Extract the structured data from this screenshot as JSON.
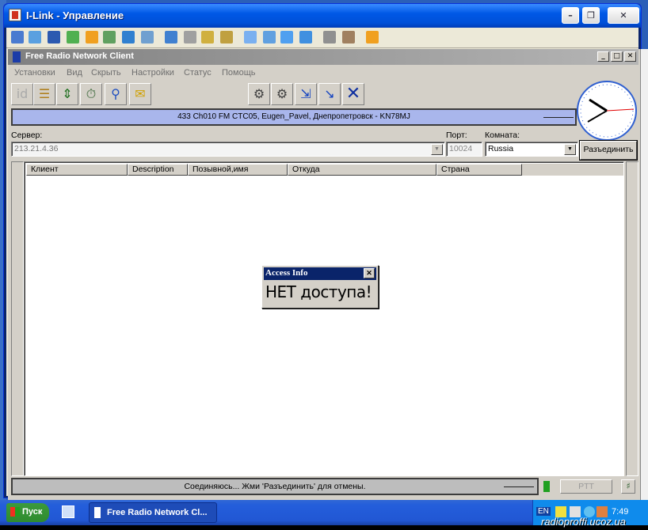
{
  "outer": {
    "title": "I-Link - Управление"
  },
  "inner": {
    "title": "Free Radio Network Client",
    "menu": [
      "Установки",
      "Вид",
      "Скрыть",
      "Настройки",
      "Статус",
      "Помощь"
    ],
    "status_text": "433 Ch010 FM CTC05, Eugen_Pavel, Днепропетровск - KN78MJ",
    "server_label": "Сервер:",
    "server_value": "213.21.4.36",
    "port_label": "Порт:",
    "port_value": "10024",
    "room_label": "Комната:",
    "room_value": "Russia",
    "disconnect_label": "Разъединить",
    "columns": [
      "Клиент",
      "Description",
      "Позывной,имя",
      "Откуда",
      "Страна"
    ],
    "connect_text": "Соединяюсь... Жми 'Разъединить' для отмены.",
    "ptt_label": "PTT"
  },
  "dialog": {
    "title": "Access Info",
    "message": "НЕТ доступа!"
  },
  "taskbar": {
    "start_label": "Пуск",
    "task_label": "Free Radio Network Cl...",
    "lang": "EN",
    "time": "7:49"
  },
  "watermark": "radioproffi.ucoz.ua"
}
